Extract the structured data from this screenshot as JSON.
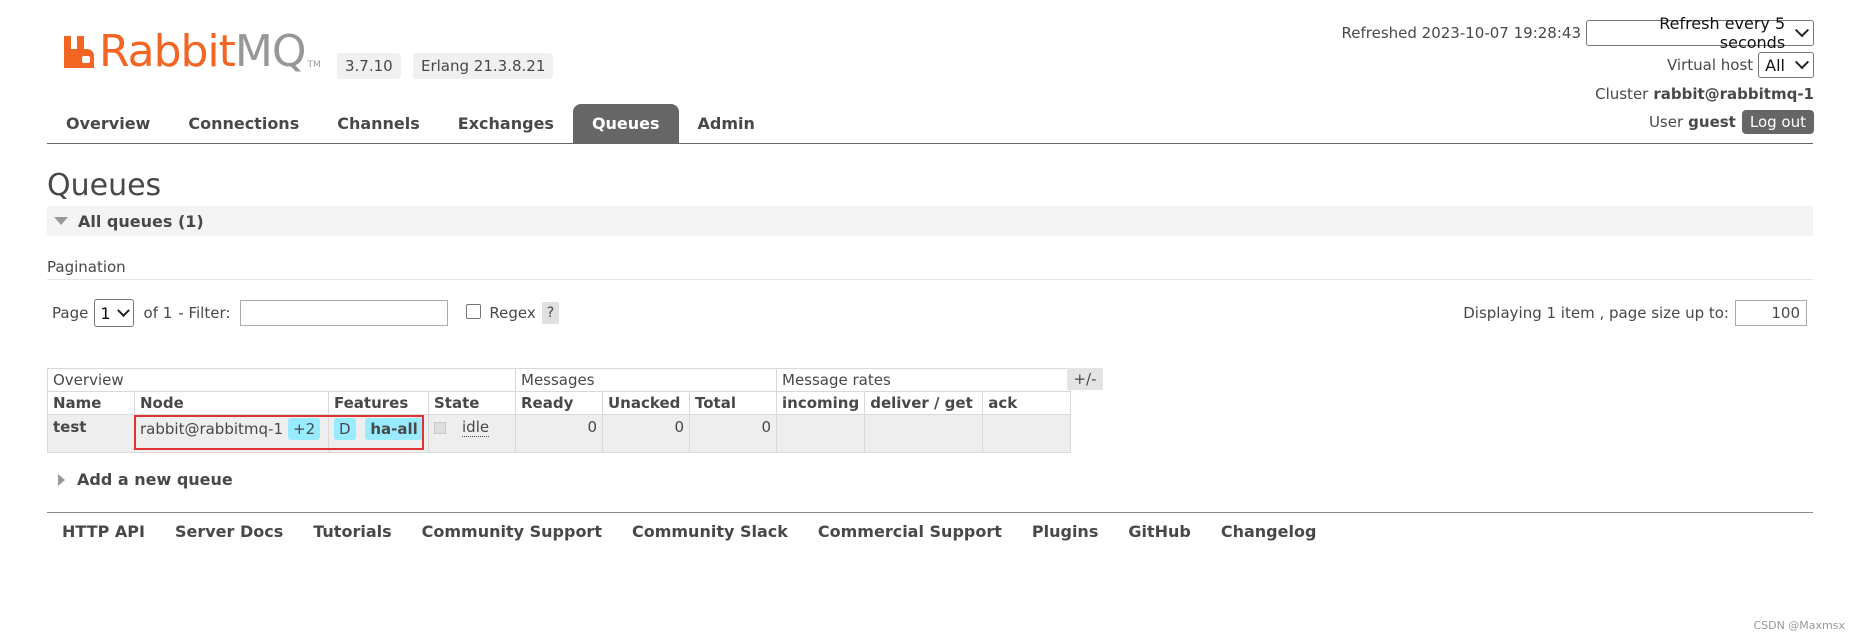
{
  "header": {
    "logo_rabbit": "Rabbit",
    "logo_mq": "MQ",
    "logo_tm": "TM",
    "version": "3.7.10",
    "erlang": "Erlang 21.3.8.21",
    "refreshed_label": "Refreshed 2023-10-07 19:28:43",
    "refresh_select": "Refresh every 5 seconds",
    "vhost_label": "Virtual host",
    "vhost_select": "All",
    "cluster_label": "Cluster",
    "cluster_value": "rabbit@rabbitmq-1",
    "user_label": "User",
    "user_value": "guest",
    "logout": "Log out"
  },
  "nav": {
    "tabs": [
      {
        "label": "Overview"
      },
      {
        "label": "Connections"
      },
      {
        "label": "Channels"
      },
      {
        "label": "Exchanges"
      },
      {
        "label": "Queues"
      },
      {
        "label": "Admin"
      }
    ],
    "active": "Queues"
  },
  "page": {
    "title": "Queues",
    "section": "All queues (1)",
    "pagination_label": "Pagination",
    "page_label": "Page",
    "page_select": "1",
    "of_label": "of 1",
    "filter_label": "- Filter:",
    "filter_value": "",
    "regex_label": "Regex",
    "help": "?",
    "displaying": "Displaying 1 item , page size up to:",
    "page_size": "100"
  },
  "table": {
    "groups": [
      "Overview",
      "Messages",
      "Message rates"
    ],
    "columns": [
      "Name",
      "Node",
      "Features",
      "State",
      "Ready",
      "Unacked",
      "Total",
      "incoming",
      "deliver / get",
      "ack"
    ],
    "plusminus": "+/-",
    "rows": [
      {
        "name": "test",
        "node": "rabbit@rabbitmq-1",
        "node_extra": "+2",
        "feature_d": "D",
        "feature_policy": "ha-all",
        "state": "idle",
        "ready": "0",
        "unacked": "0",
        "total": "0",
        "incoming": "",
        "deliver_get": "",
        "ack": ""
      }
    ]
  },
  "add_queue": "Add a new queue",
  "footer": {
    "links": [
      "HTTP API",
      "Server Docs",
      "Tutorials",
      "Community Support",
      "Community Slack",
      "Commercial Support",
      "Plugins",
      "GitHub",
      "Changelog"
    ]
  },
  "watermark": "CSDN @Maxmsx",
  "colors": {
    "accent_orange": "#f26522",
    "tab_active": "#666666",
    "tag_blue": "#99ebff",
    "highlight_red": "#e03232"
  }
}
